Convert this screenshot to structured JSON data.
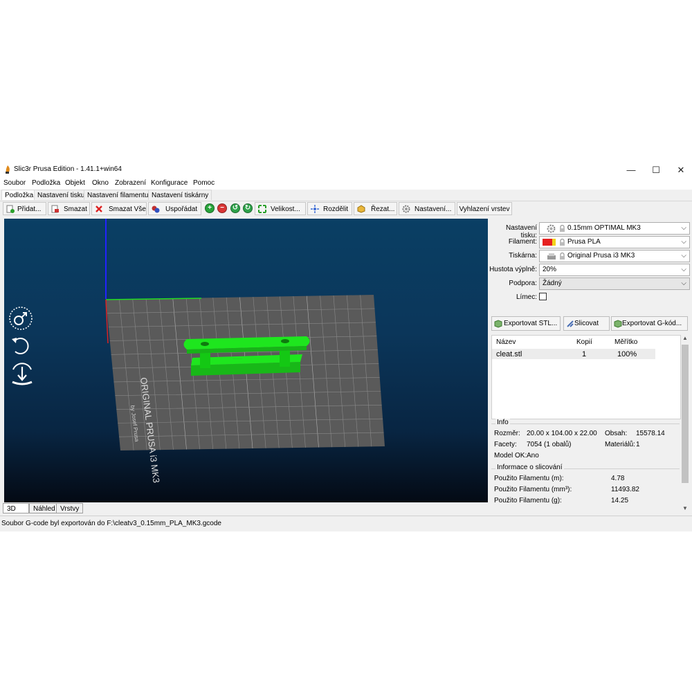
{
  "window": {
    "title": "Slic3r Prusa Edition - 1.41.1+win64",
    "minimize": "—",
    "maximize": "☐",
    "close": "✕"
  },
  "menu": [
    "Soubor",
    "Podložka",
    "Objekt",
    "Okno",
    "Zobrazení",
    "Konfigurace",
    "Pomoc"
  ],
  "tabs": [
    "Podložka",
    "Nastavení tisku",
    "Nastavení filamentu",
    "Nastavení tiskárny"
  ],
  "toolbar": {
    "add": "Přidat...",
    "delete": "Smazat",
    "delete_all": "Smazat Vše",
    "arrange": "Uspořádat",
    "scale": "Velikost...",
    "split": "Rozdělit",
    "cut": "Řezat...",
    "settings": "Nastavení...",
    "layer_smoothing": "Vyhlazení vrstev",
    "icons": [
      "plus-icon",
      "minus-icon",
      "rotate-left-icon",
      "rotate-right-icon",
      "scale-icon"
    ]
  },
  "viewport": {
    "bed_label_main": "ORIGINAL PRUSA i3 MK3",
    "bed_label_sub": "by Josef Prusa",
    "model_color": "#1ee61e",
    "bed_color": "#5a5a5a",
    "icons": [
      "gender-icon",
      "undo-arrow-icon",
      "drop-to-bed-icon"
    ]
  },
  "view_tabs": [
    "3D",
    "Náhled",
    "Vrstvy"
  ],
  "settings": {
    "print_label": "Nastavení tisku:",
    "print_value": "0.15mm OPTIMAL MK3",
    "filament_label": "Filament:",
    "filament_value": "Prusa PLA",
    "filament_swatch": "#e62020",
    "printer_label": "Tiskárna:",
    "printer_value": "Original Prusa i3 MK3",
    "infill_label": "Hustota výplně:",
    "infill_value": "20%",
    "support_label": "Podpora:",
    "support_value": "Žádný",
    "brim_label": "Límec:"
  },
  "actions": {
    "export_stl": "Exportovat STL...",
    "slice": "Slicovat",
    "export_gcode": "Exportovat G-kód..."
  },
  "objects": {
    "headers": [
      "Název",
      "Kopií",
      "Měřítko"
    ],
    "rows": [
      {
        "name": "cleat.stl",
        "copies": "1",
        "scale": "100%"
      }
    ]
  },
  "info": {
    "title": "Info",
    "size_label": "Rozměr:",
    "size_value": "20.00 x 104.00 x 22.00",
    "volume_label": "Obsah:",
    "volume_value": "15578.14",
    "facets_label": "Facety:",
    "facets_value": "7054 (1 obalů)",
    "materials_label": "Materiálů:",
    "materials_value": "1",
    "model_ok_label": "Model OK:",
    "model_ok_value": "Ano"
  },
  "slice_info": {
    "title": "Informace o slicování",
    "rows": [
      {
        "label": "Použito Filamentu (m):",
        "value": "4.78"
      },
      {
        "label": "Použito Filamentu (mm³):",
        "value": "11493.82"
      },
      {
        "label": "Použito Filamentu (g):",
        "value": "14.25"
      }
    ]
  },
  "status": "Soubor G-code byl exportován do F:\\cleatv3_0.15mm_PLA_MK3.gcode"
}
